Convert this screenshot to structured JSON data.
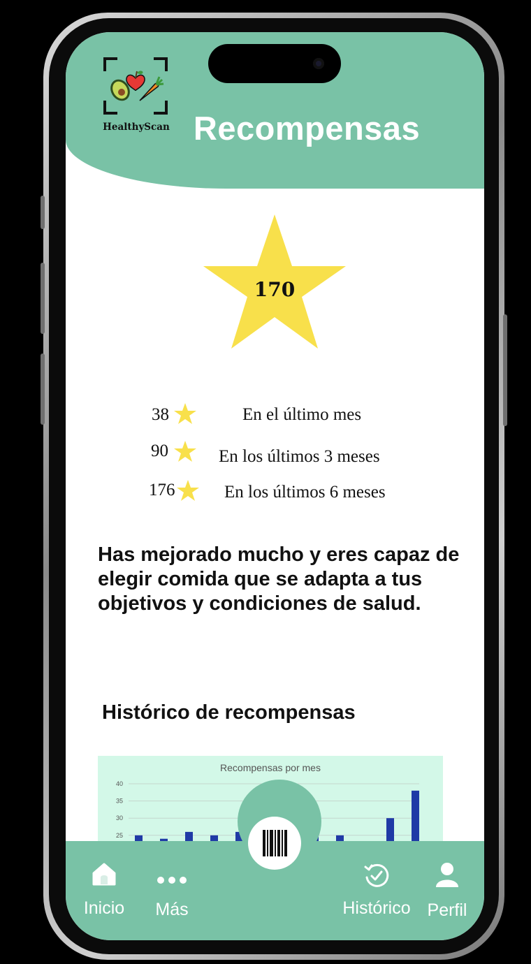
{
  "app": {
    "logo_text": "HealthyScan",
    "title": "Recompensas",
    "accent_color": "#79c2a6",
    "star_color": "#f8e04b"
  },
  "total": {
    "value": "170"
  },
  "stats": [
    {
      "value": "38",
      "label": "En el último mes"
    },
    {
      "value": "90",
      "label": "En los últimos 3 meses"
    },
    {
      "value": "176",
      "label": "En los últimos 6 meses"
    }
  ],
  "message": "Has mejorado mucho y eres capaz de elegir comida que se adapta a tus objetivos y condiciones de salud.",
  "history": {
    "title": "Histórico de recompensas"
  },
  "chart_data": {
    "type": "bar",
    "title": "Recompensas por mes",
    "y_ticks": [
      "40",
      "35",
      "30",
      "25"
    ],
    "ylim": [
      0,
      40
    ],
    "grid": true,
    "bar_color": "#1f3aa6",
    "values": [
      25,
      24,
      26,
      25,
      26,
      24,
      25,
      30,
      25,
      20,
      30,
      38
    ]
  },
  "nav": {
    "home_label": "Inicio",
    "more_label": "Más",
    "history_label": "Histórico",
    "profile_label": "Perfil"
  }
}
